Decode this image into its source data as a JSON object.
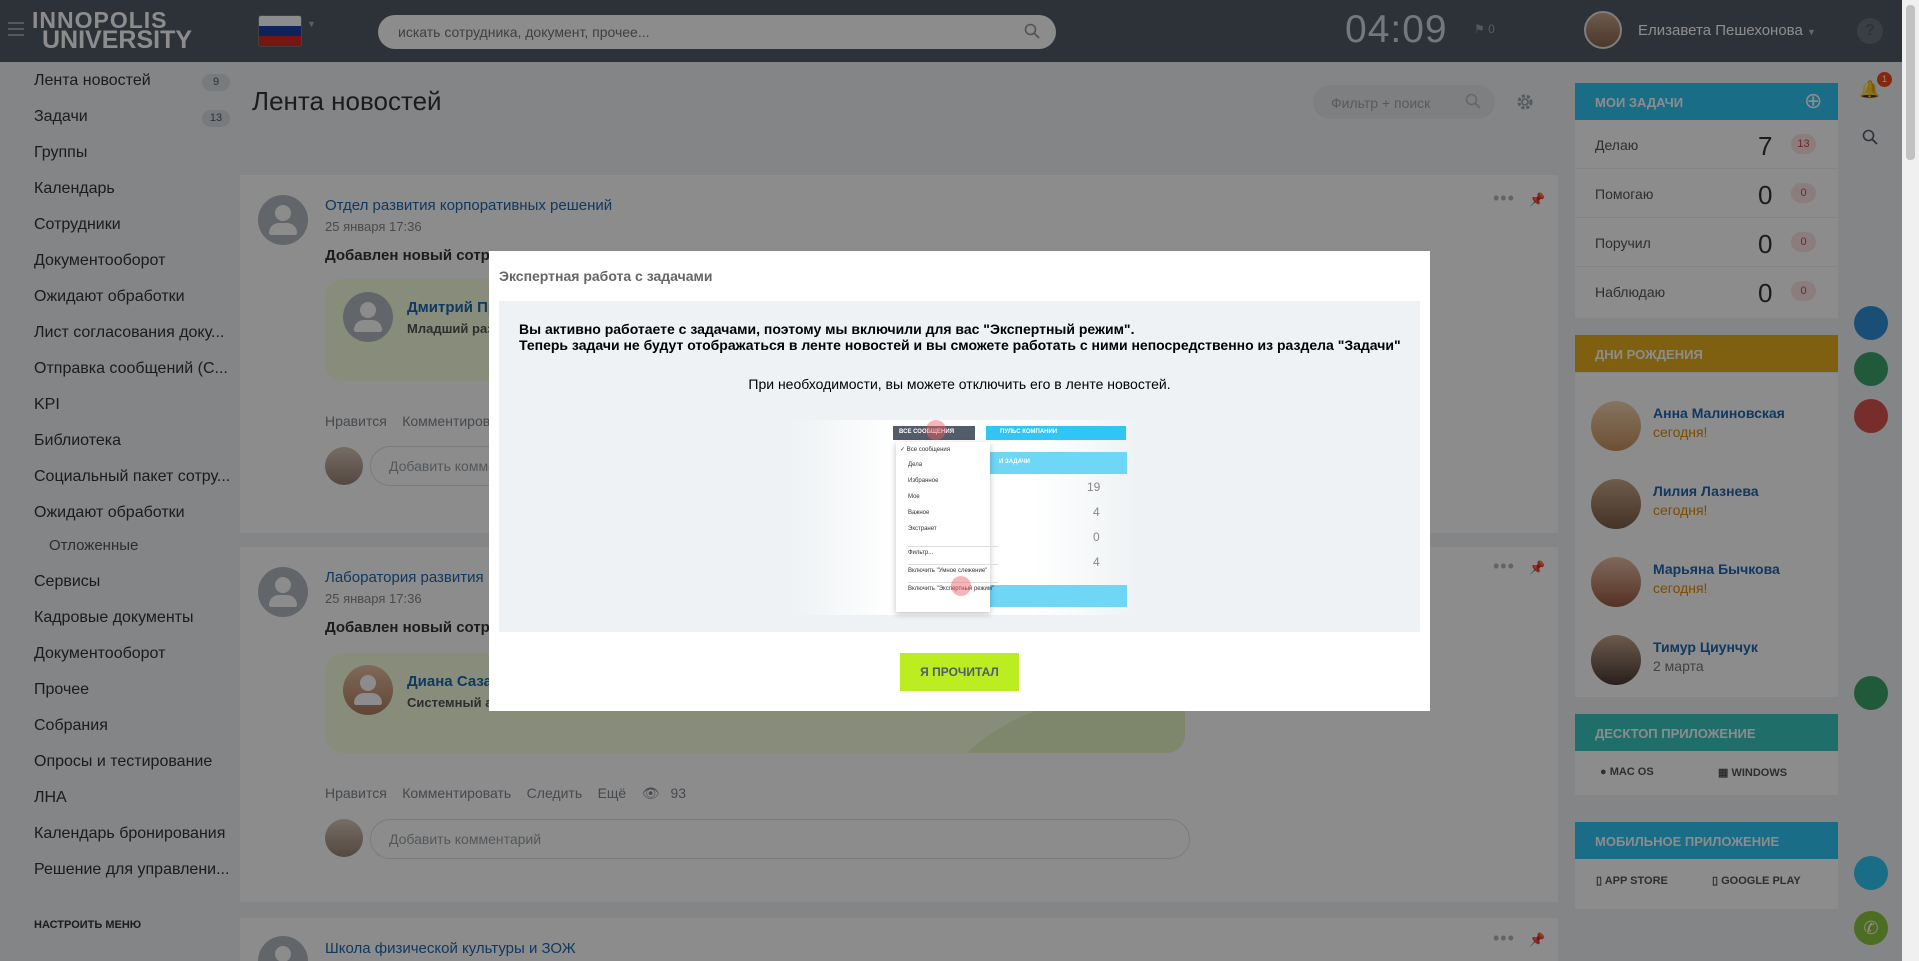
{
  "logo": {
    "line1": "innopolis",
    "line2": "university"
  },
  "search": {
    "placeholder": "искать сотрудника, документ, прочее..."
  },
  "clock": "04:09",
  "flag_count": "0",
  "user": {
    "name": "Елизавета Пешехонова"
  },
  "help": "?",
  "sidebar": {
    "items": [
      {
        "label": "Лента новостей",
        "count": "9"
      },
      {
        "label": "Задачи",
        "count": "13"
      },
      {
        "label": "Группы"
      },
      {
        "label": "Календарь"
      },
      {
        "label": "Сотрудники"
      },
      {
        "label": "Документооборот"
      },
      {
        "label": "Ожидают обработки"
      },
      {
        "label": "Лист согласования доку..."
      },
      {
        "label": "Отправка сообщений (С..."
      },
      {
        "label": "KPI"
      },
      {
        "label": "Библиотека"
      },
      {
        "label": "Социальный пакет сотру..."
      },
      {
        "label": "Ожидают обработки"
      },
      {
        "label": "Отложенные"
      },
      {
        "label": "Сервисы"
      },
      {
        "label": "Кадровые документы"
      },
      {
        "label": "Документооборот"
      },
      {
        "label": "Прочее"
      },
      {
        "label": "Собрания"
      },
      {
        "label": "Опросы и тестирование"
      },
      {
        "label": "ЛНА"
      },
      {
        "label": "Календарь бронирования"
      },
      {
        "label": "Решение для управлени..."
      }
    ],
    "configure": "НАСТРОИТЬ МЕНЮ"
  },
  "main": {
    "title": "Лента новостей",
    "filter_placeholder": "Фильтр + поиск",
    "posts": [
      {
        "author": "Отдел развития корпоративных решений",
        "date": "25 января 17:36",
        "text": "Добавлен новый сотруд",
        "person": "Дмитрий Пр",
        "role": "Младший разр",
        "actions": [
          "Нравится",
          "Комментироват"
        ],
        "comment_placeholder": "Добавить коммен"
      },
      {
        "author": "Лаборатория развития",
        "date": "25 января 17:36",
        "text": "Добавлен новый сотруд",
        "person": "Диана Сазан",
        "role": "Системный ан",
        "actions": [
          "Нравится",
          "Комментировать",
          "Следить",
          "Ещё"
        ],
        "views": "93",
        "comment_placeholder": "Добавить комментарий"
      },
      {
        "author": "Школа физической культуры и ЗОЖ"
      }
    ]
  },
  "tasks": {
    "header": "МОИ ЗАДАЧИ",
    "rows": [
      {
        "label": "Делаю",
        "count": "7",
        "badge": "13"
      },
      {
        "label": "Помогаю",
        "count": "0",
        "badge": "0"
      },
      {
        "label": "Поручил",
        "count": "0",
        "badge": "0"
      },
      {
        "label": "Наблюдаю",
        "count": "0",
        "badge": "0"
      }
    ]
  },
  "birthdays": {
    "header": "ДНИ РОЖДЕНИЯ",
    "people": [
      {
        "name": "Анна Малиновская",
        "date": "сегодня!"
      },
      {
        "name": "Лилия Лазнева",
        "date": "сегодня!"
      },
      {
        "name": "Марьяна Бычкова",
        "date": "сегодня!"
      },
      {
        "name": "Тимур Циунчук",
        "date": "2 марта"
      }
    ]
  },
  "desktop_app": {
    "header": "ДЕСКТОП ПРИЛОЖЕНИЕ",
    "mac": "MAC OS",
    "windows": "WINDOWS"
  },
  "mobile_app": {
    "header": "МОБИЛЬНОЕ ПРИЛОЖЕНИЕ",
    "appstore": "APP STORE",
    "googleplay": "GOOGLE PLAY"
  },
  "notifications_badge": "1",
  "modal": {
    "title": "Экспертная работа с задачами",
    "line1": "Вы активно работаете с задачами, поэтому мы включили для вас \"Экспертный режим\".",
    "line2": "Теперь задачи не будут отображаться в ленте новостей и вы сможете работать с ними непосредственно из раздела \"Задачи\"",
    "line3": "При необходимости, вы можете отключить его в ленте новостей.",
    "button": "Я ПРОЧИТАЛ",
    "shot": {
      "menu_button": "ВСЕ СООБЩЕНИЯ",
      "menu_items": [
        "Все сообщения",
        "Дела",
        "Избранное",
        "Мое",
        "Важное",
        "Экстранет",
        "Фильтр...",
        "Включить \"Умное слежение\"",
        "Включить \"Экспертный режим\""
      ],
      "pulse": "ПУЛЬС КОМПАНИИ",
      "tasks_header": "И ЗАДАЧИ",
      "tasks": [
        "19",
        "4",
        "0",
        "4"
      ]
    }
  },
  "colors": {
    "topbar": "#535c69",
    "tasks": "#2fc6f6",
    "birthdays": "#e8b020",
    "desktop": "#3bc8c2",
    "mobile": "#2fc6f6",
    "button": "#bbed21"
  }
}
